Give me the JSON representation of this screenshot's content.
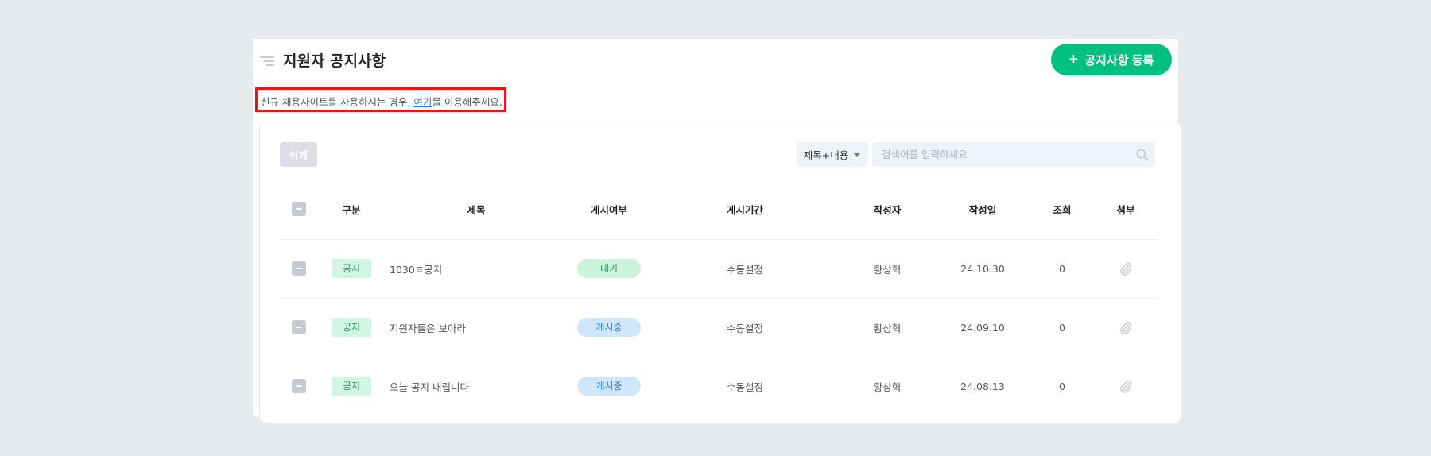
{
  "header": {
    "title": "지원자 공지사항",
    "add_button": "공지사항 등록",
    "add_icon": "plus-icon"
  },
  "notice": {
    "before": "신규 채용사이트를 사용하시는 경우, ",
    "link": "여기",
    "after": "를 이용해주세요."
  },
  "toolbar": {
    "delete": "삭제",
    "filter_selected": "제목+내용",
    "search_placeholder": "검색어를 입력하세요"
  },
  "columns": [
    "구분",
    "제목",
    "게시여부",
    "게시기간",
    "작성자",
    "작성일",
    "조회",
    "첨부"
  ],
  "rows": [
    {
      "type": "공지",
      "title": "1030ㅌ공지",
      "status": "대기",
      "period": "수동설정",
      "author": "황상혁",
      "date": "24.10.30",
      "views": "0"
    },
    {
      "type": "공지",
      "title": "지원자들은 보아라",
      "status": "게시중",
      "period": "수동설정",
      "author": "황상혁",
      "date": "24.09.10",
      "views": "0"
    },
    {
      "type": "공지",
      "title": "오늘 공지 내립니다",
      "status": "게시중",
      "period": "수동설정",
      "author": "황상혁",
      "date": "24.08.13",
      "views": "0"
    }
  ],
  "colors": {
    "accent": "#00c07f",
    "waiting_bg": "#cdf3df",
    "waiting_fg": "#1aa15a",
    "posted_bg": "#cfe6fb",
    "posted_fg": "#2d7fd0"
  }
}
